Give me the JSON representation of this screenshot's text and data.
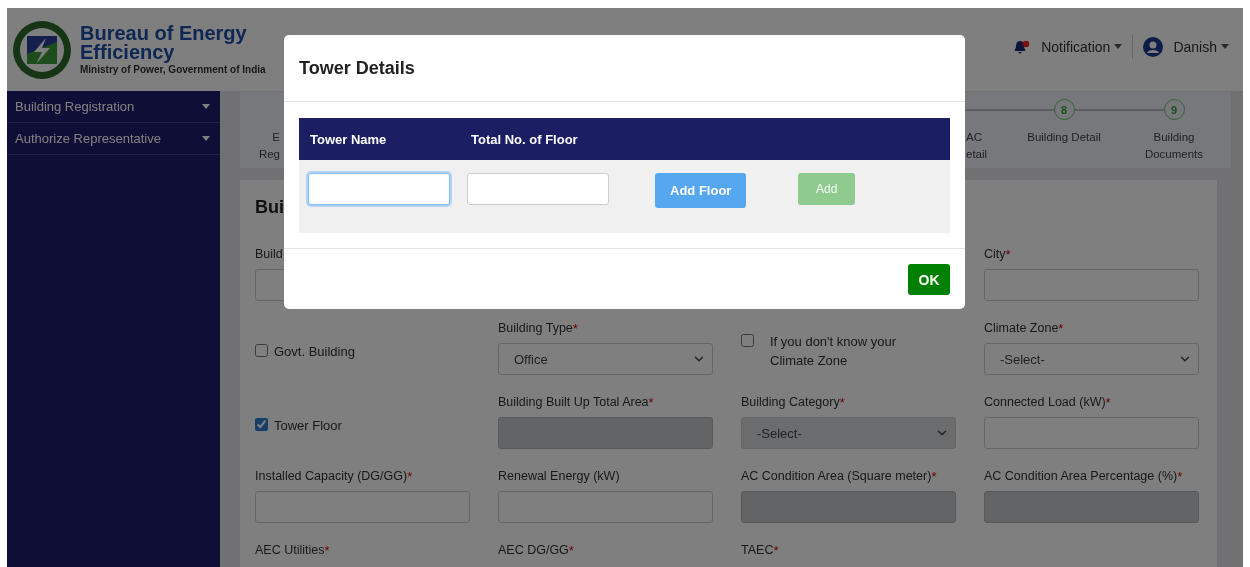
{
  "header": {
    "org_name": "Bureau of Energy Efficiency",
    "org_subtitle": "Ministry of Power, Government of India",
    "notification": {
      "label": "Notification",
      "unread": true
    },
    "user": {
      "name": "Danish"
    }
  },
  "sidebar": {
    "items": [
      {
        "label": "Building Registration",
        "expanded": false
      },
      {
        "label": "Authorize Representative",
        "expanded": false
      }
    ]
  },
  "stepper": {
    "left_step": {
      "label_lines": [
        "E",
        "Reg"
      ]
    },
    "steps": [
      {
        "label_lines": [
          "AC",
          "etail"
        ]
      },
      {
        "number": "8",
        "label_lines": [
          "Building Detail"
        ]
      },
      {
        "number": "9",
        "label_lines": [
          "Building",
          "Documents"
        ]
      }
    ]
  },
  "form": {
    "heading": "Bui",
    "rows": [
      [
        {
          "kind": "input",
          "label": "Build",
          "disabled": false
        },
        {
          "kind": "covered"
        },
        {
          "kind": "covered"
        },
        {
          "kind": "input",
          "label": "City",
          "required_mark": "*",
          "disabled": false
        }
      ],
      [
        {
          "kind": "checkbox",
          "label": "Govt. Building",
          "checked": false
        },
        {
          "kind": "select",
          "label": "Building Type",
          "required_mark": "*",
          "value": "Office",
          "disabled": false
        },
        {
          "kind": "checkbox",
          "label": "If you don't know your Climate Zone",
          "checked": false
        },
        {
          "kind": "select",
          "label": "Climate Zone",
          "required_mark": "*",
          "value": "-Select-",
          "disabled": false
        }
      ],
      [
        {
          "kind": "checkbox",
          "label": "Tower Floor",
          "checked": true
        },
        {
          "kind": "input",
          "label": "Building Built Up Total Area",
          "required_mark": "*",
          "disabled": true
        },
        {
          "kind": "select",
          "label": "Building Category",
          "required_mark": "*",
          "value": "-Select-",
          "disabled": true
        },
        {
          "kind": "input",
          "label": "Connected Load (kW)",
          "required_mark": "*",
          "disabled": false
        }
      ],
      [
        {
          "kind": "input",
          "label": "Installed Capacity (DG/GG)",
          "required_mark": "*",
          "disabled": false
        },
        {
          "kind": "input",
          "label": "Renewal Energy (kW)",
          "disabled": false
        },
        {
          "kind": "input",
          "label": "AC Condition Area (Square meter)",
          "required_mark": "*",
          "disabled": true
        },
        {
          "kind": "input",
          "label": "AC Condition Area Percentage (%)",
          "required_mark": "*",
          "disabled": true
        }
      ],
      [
        {
          "kind": "label",
          "label": "AEC Utilities",
          "required_mark": "*"
        },
        {
          "kind": "label",
          "label": "AEC DG/GG",
          "required_mark": "*"
        },
        {
          "kind": "label",
          "label": "TAEC",
          "required_mark": "*"
        },
        {
          "kind": "covered"
        }
      ]
    ]
  },
  "modal": {
    "title": "Tower Details",
    "columns": [
      "Tower Name",
      "Total No. of Floor"
    ],
    "inputs": [
      {
        "focused": true
      },
      {
        "focused": false
      }
    ],
    "buttons": [
      {
        "kind": "primary",
        "label": "Add Floor",
        "disabled": false
      },
      {
        "kind": "success",
        "label": "Add",
        "disabled": true
      }
    ],
    "ok_button": {
      "label": "OK"
    }
  }
}
